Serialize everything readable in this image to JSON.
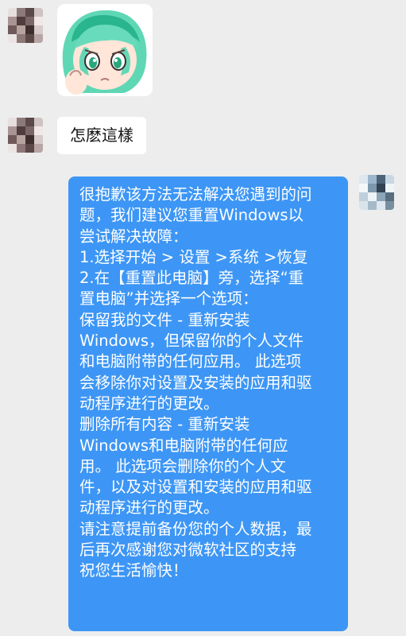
{
  "chat": {
    "incoming_text": "怎麽這樣",
    "reply_lines": [
      "很抱歉该方法无法解决您遇到的问",
      "题，我们建议您重置Windows以",
      "尝试解决故障：",
      "1.选择开始  > 设置  >系统  >恢复",
      "2.在【重置此电脑】旁，选择“重",
      "置电脑”并选择一个选项：",
      "保留我的文件 - 重新安装",
      "Windows，但保留你的个人文件",
      "和电脑附带的任何应用。 此选项",
      "会移除你对设置及安装的应用和驱",
      "动程序进行的更改。",
      "删除所有内容 - 重新安装",
      "Windows和电脑附带的任何应",
      "用。 此选项会删除你的个人文",
      "件，以及对设置和安装的应用和驱",
      "动程序进行的更改。",
      "请注意提前备份您的个人数据，最",
      "后再次感谢您对微软社区的支持",
      "祝您生活愉快！"
    ]
  },
  "colors": {
    "background": "#ededed",
    "incoming_bubble": "#ffffff",
    "outgoing_bubble": "#3d96f5"
  },
  "icons": {
    "left_avatar": "pixelated-avatar-icon",
    "sticker": "anime-girl-sticker",
    "right_avatar": "pixelated-avatar-icon"
  }
}
